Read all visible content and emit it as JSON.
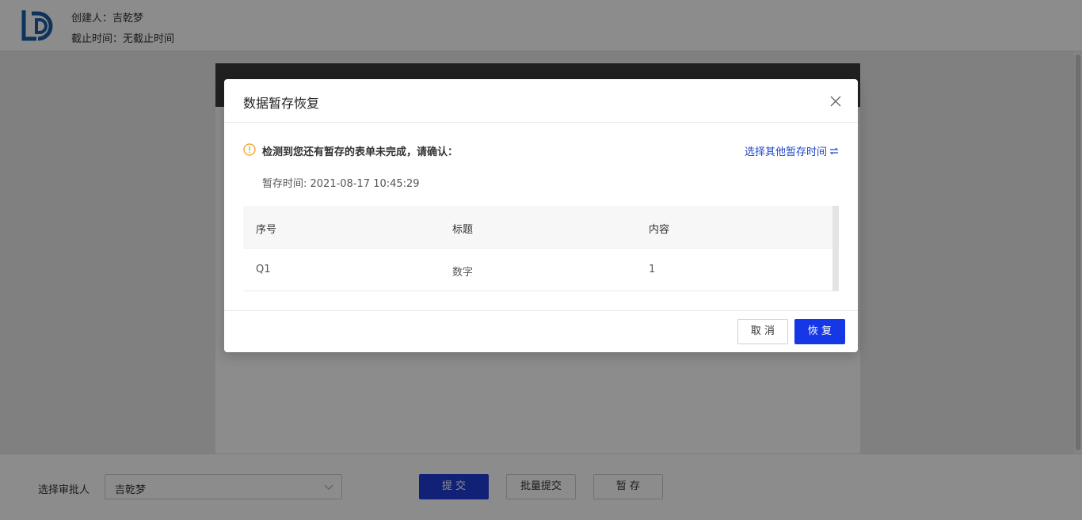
{
  "header": {
    "creator_label": "创建人：吉乾梦",
    "deadline_label": "截止时间：无截止时间"
  },
  "form_card": {
    "title": ""
  },
  "footer": {
    "approver_label": "选择审批人",
    "approver_value": "吉乾梦",
    "submit_label": "提 交",
    "batch_submit_label": "批量提交",
    "stash_label": "暂 存"
  },
  "modal": {
    "title": "数据暂存恢复",
    "notice": "检测到您还有暂存的表单未完成，请确认：",
    "other_time_link": "选择其他暂存时间",
    "stash_time": "暂存时间: 2021-08-17 10:45:29",
    "table": {
      "headers": [
        "序号",
        "标题",
        "内容"
      ],
      "rows": [
        [
          "Q1",
          "数字",
          "1"
        ]
      ]
    },
    "cancel_label": "取 消",
    "restore_label": "恢 复"
  },
  "colors": {
    "primary": "#1537e6",
    "link": "#1f47c8",
    "warning": "#f0a020",
    "logo": "#1d5fa8"
  },
  "icons": {
    "logo": "ld-logo-icon",
    "close": "close-icon",
    "warning": "info-circle-icon",
    "switch": "switch-icon",
    "chevron": "chevron-down-icon"
  }
}
